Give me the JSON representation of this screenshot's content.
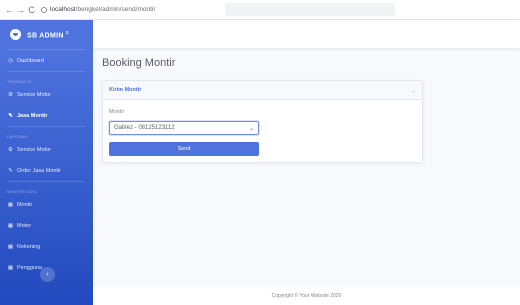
{
  "browser": {
    "back": "←",
    "forward": "→",
    "reload": "C",
    "url_host": "localhost",
    "url_path": "/bengkel/admin/send/montir"
  },
  "sidebar": {
    "brand": "SB ADMIN",
    "brand_sup": "2",
    "dashboard": "Dashboard",
    "heading_transaksi": "TRANSAKSI",
    "service_motor": "Service Motor",
    "jasa_montir": "Jasa Montir",
    "heading_laporan": "LAPORAN",
    "service_motor_report": "Service Motor",
    "order_jasa_montir": "Order Jasa Montir",
    "heading_master": "MASTER DATA",
    "montir": "Montir",
    "motor": "Motor",
    "rekening": "Rekening",
    "pengguna": "Pengguna",
    "toggle": "‹"
  },
  "main": {
    "title": "Booking Montir",
    "card_title": "Kirim Montir",
    "label": "Montir",
    "select_value": "Galirez - 08125123112",
    "button": "Send"
  },
  "footer": {
    "text": "Copyright © Your Website 2020"
  },
  "colors": {
    "primary": "#4e73df",
    "background": "#f8f9fc"
  }
}
